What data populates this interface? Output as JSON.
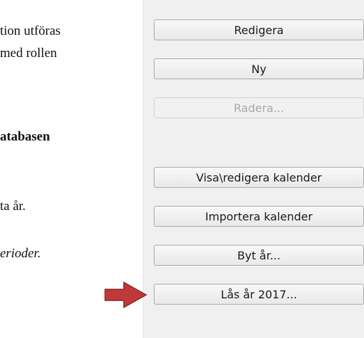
{
  "document": {
    "lines": [
      "tion utföras",
      "med rollen",
      "atabasen",
      "ta år.",
      "erioder."
    ]
  },
  "buttons": {
    "edit": "Redigera",
    "new": "Ny",
    "delete": "Radera...",
    "view_edit_calendar": "Visa\\redigera kalender",
    "import_calendar": "Importera kalender",
    "change_year": "Byt år...",
    "lock_year": "Lås år 2017..."
  },
  "colors": {
    "arrow": "#c0393a",
    "arrow_dark": "#8e2426",
    "panel_bg": "#f0f0f0"
  }
}
